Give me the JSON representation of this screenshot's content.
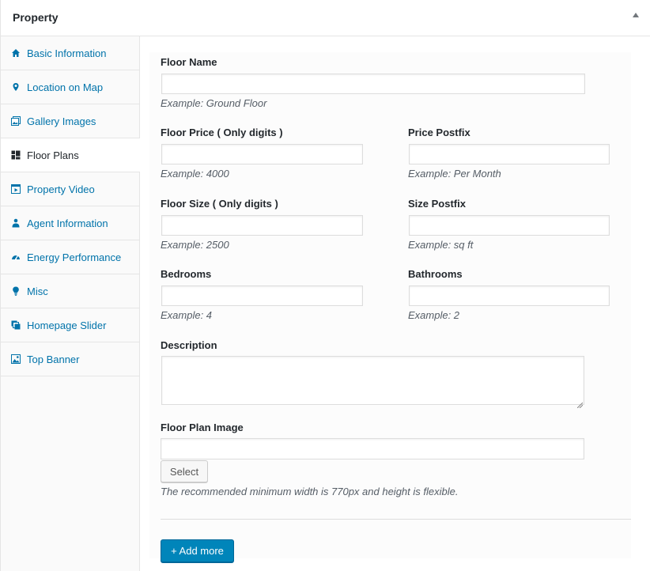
{
  "metabox": {
    "title": "Property"
  },
  "sidebar": {
    "items": [
      {
        "label": "Basic Information",
        "icon": "home-icon",
        "active": false
      },
      {
        "label": "Location on Map",
        "icon": "location-pin-icon",
        "active": false
      },
      {
        "label": "Gallery Images",
        "icon": "gallery-icon",
        "active": false
      },
      {
        "label": "Floor Plans",
        "icon": "floor-plans-icon",
        "active": true
      },
      {
        "label": "Property Video",
        "icon": "video-icon",
        "active": false
      },
      {
        "label": "Agent Information",
        "icon": "agent-icon",
        "active": false
      },
      {
        "label": "Energy Performance",
        "icon": "dashboard-gauge-icon",
        "active": false
      },
      {
        "label": "Misc",
        "icon": "lightbulb-icon",
        "active": false
      },
      {
        "label": "Homepage Slider",
        "icon": "slides-icon",
        "active": false
      },
      {
        "label": "Top Banner",
        "icon": "banner-image-icon",
        "active": false
      }
    ]
  },
  "form": {
    "floor_name": {
      "label": "Floor Name",
      "value": "",
      "hint": "Example: Ground Floor"
    },
    "floor_price": {
      "label": "Floor Price ( Only digits )",
      "value": "",
      "hint": "Example: 4000"
    },
    "price_postfix": {
      "label": "Price Postfix",
      "value": "",
      "hint": "Example: Per Month"
    },
    "floor_size": {
      "label": "Floor Size ( Only digits )",
      "value": "",
      "hint": "Example: 2500"
    },
    "size_postfix": {
      "label": "Size Postfix",
      "value": "",
      "hint": "Example: sq ft"
    },
    "bedrooms": {
      "label": "Bedrooms",
      "value": "",
      "hint": "Example: 4"
    },
    "bathrooms": {
      "label": "Bathrooms",
      "value": "",
      "hint": "Example: 2"
    },
    "description": {
      "label": "Description",
      "value": ""
    },
    "floor_plan_image": {
      "label": "Floor Plan Image",
      "value": "",
      "select_label": "Select",
      "hint": "The recommended minimum width is 770px and height is flexible."
    },
    "add_more_label": "+ Add more"
  },
  "colors": {
    "link": "#0073aa",
    "primary_button": "#0085ba",
    "text": "#23282d",
    "hint": "#555d66"
  }
}
